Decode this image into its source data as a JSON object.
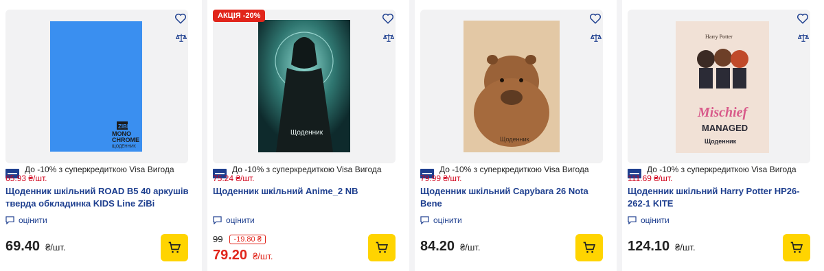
{
  "visa_text": "До -10% з суперкредиткою Visa Вигода",
  "unit": "₴/шт.",
  "rate_label": "оцінити",
  "products": [
    {
      "title_line1": "Щоденник шкільний ROAD B5 40 аркушів",
      "title_line2": "тверда обкладинка KIDS Line ZiBi",
      "visa_price": "65.93 ₴/шт.",
      "price": "69.40"
    },
    {
      "promo": "АКЦІЯ -20%",
      "title_line1": "Щоденник шкільний Anime_2 NB",
      "title_line2": "",
      "visa_price": "75.24 ₴/шт.",
      "old_price": "99",
      "discount": "-19.80 ₴",
      "price": "79.20",
      "cover_text": "Щоденник"
    },
    {
      "title_line1": "Щоденник шкільний Capybara 26 Nota",
      "title_line2": "Bene",
      "visa_price": "79.99 ₴/шт.",
      "price": "84.20",
      "cover_text": "Щоденник"
    },
    {
      "title_line1": "Щоденник шкільний Harry Potter HP26-",
      "title_line2": "262-1 KITE",
      "visa_price": "111.69 ₴/шт.",
      "price": "124.10",
      "cover_text_1": "Harry Potter",
      "cover_text_2": "Mischief",
      "cover_text_3": "MANAGED",
      "cover_text_4": "Щоденник"
    }
  ],
  "zibi_cover": {
    "brand": "ZIBI",
    "line1": "MONO",
    "line2": "CHROME",
    "line3": "ЩОДЕННИК"
  }
}
